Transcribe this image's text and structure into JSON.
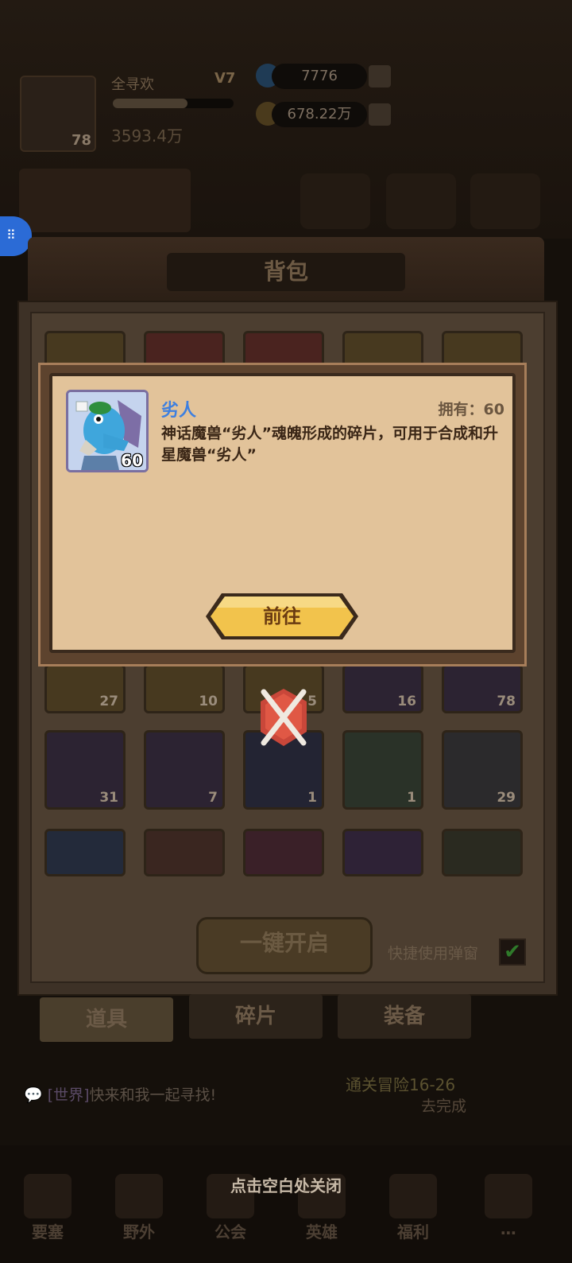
{
  "hud": {
    "player_name": "全寻欢",
    "player_level": "78",
    "vip": "V7",
    "power": "3593.4万",
    "diamonds": "7776",
    "gold": "678.22万",
    "exp_progress": 0.62
  },
  "bag": {
    "title": "背包",
    "row_counts_1": [
      "27",
      "10",
      "5",
      "16",
      "78"
    ],
    "row_counts_2": [
      "31",
      "7",
      "1",
      "1",
      "29"
    ],
    "open_all_label": "一键开启",
    "quick_use_label": "快捷使用弹窗",
    "quick_use_checked": true,
    "tabs": [
      "道具",
      "碎片",
      "装备"
    ]
  },
  "chat": {
    "channel": "[世界]",
    "message": "快来和我一起寻找!"
  },
  "quest": {
    "name": "通关冒险16-26",
    "action": "去完成"
  },
  "bottom_nav": [
    "要塞",
    "野外",
    "公会",
    "英雄",
    "福利",
    "⋯"
  ],
  "close_hint": "点击空白处关闭",
  "popup": {
    "item_name": "劣人",
    "owned_label": "拥有：60",
    "icon_count": "60",
    "description": "神话魔兽“劣人”魂魄形成的碎片，可用于合成和升星魔兽“劣人”",
    "goto_label": "前往"
  },
  "colors": {
    "item_name": "#3d7fe0",
    "popup_bg": "#e2c39a",
    "button_gold": "#f2c34c"
  }
}
